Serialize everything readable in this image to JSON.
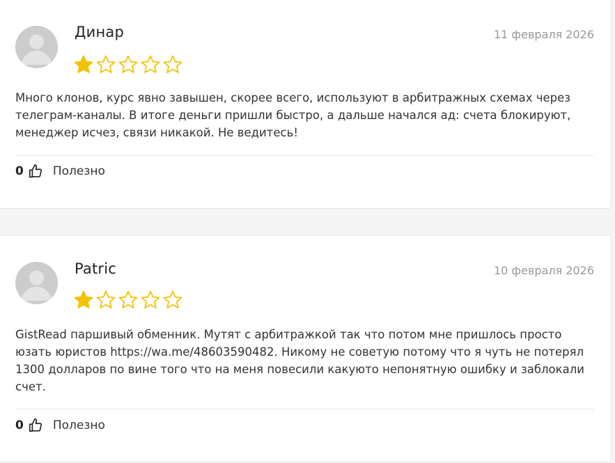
{
  "reviews": [
    {
      "author": "Динар",
      "date": "11 февраля 2026",
      "rating": 1,
      "max_rating": 5,
      "text": "Много клонов, курс явно завышен, скорее всего, используют в арбитражных схемах через телеграм-каналы. В итоге деньги пришли быстро, а дальше начался ад: счета блокируют, менеджер исчез, связи никакой. Не ведитесь!",
      "likes": "0",
      "useful_label": "Полезно"
    },
    {
      "author": "Patric",
      "date": "10 февраля 2026",
      "rating": 1,
      "max_rating": 5,
      "text_before": "GistRead паршивый обменник. Мутят с арбитражкой так что потом мне пришлось просто юзать юристов ",
      "link": "https://wa.me/48603590482",
      "text_after": ". Никому не советую потому что я чуть не потерял 1300 долларов по вине того что на меня повесили какуюто непонятную ошибку и заблокали счет.",
      "likes": "0",
      "useful_label": "Полезно"
    }
  ],
  "colors": {
    "star_filled": "#f2c200",
    "star_outline": "#f2c200",
    "date": "#999999",
    "text": "#333333"
  },
  "icons": {
    "avatar": "user-avatar-icon",
    "star": "star-icon",
    "like": "thumbs-up-icon"
  }
}
